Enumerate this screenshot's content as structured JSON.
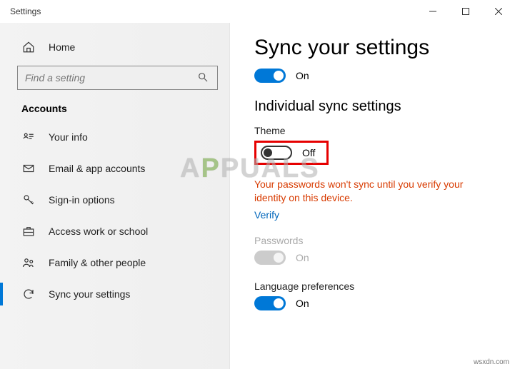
{
  "window": {
    "title": "Settings"
  },
  "sidebar": {
    "home": "Home",
    "search_placeholder": "Find a setting",
    "section": "Accounts",
    "items": [
      {
        "label": "Your info"
      },
      {
        "label": "Email & app accounts"
      },
      {
        "label": "Sign-in options"
      },
      {
        "label": "Access work or school"
      },
      {
        "label": "Family & other people"
      },
      {
        "label": "Sync your settings"
      }
    ]
  },
  "main": {
    "title": "Sync your settings",
    "master": {
      "state": "On"
    },
    "subhead": "Individual sync settings",
    "theme": {
      "label": "Theme",
      "state": "Off"
    },
    "warning": "Your passwords won't sync until you verify your identity on this device.",
    "verify": "Verify",
    "passwords": {
      "label": "Passwords",
      "state": "On"
    },
    "language": {
      "label": "Language preferences",
      "state": "On"
    }
  },
  "watermark": {
    "text_left": "A",
    "text_right": "PUALS",
    "credit": "wsxdn.com"
  }
}
